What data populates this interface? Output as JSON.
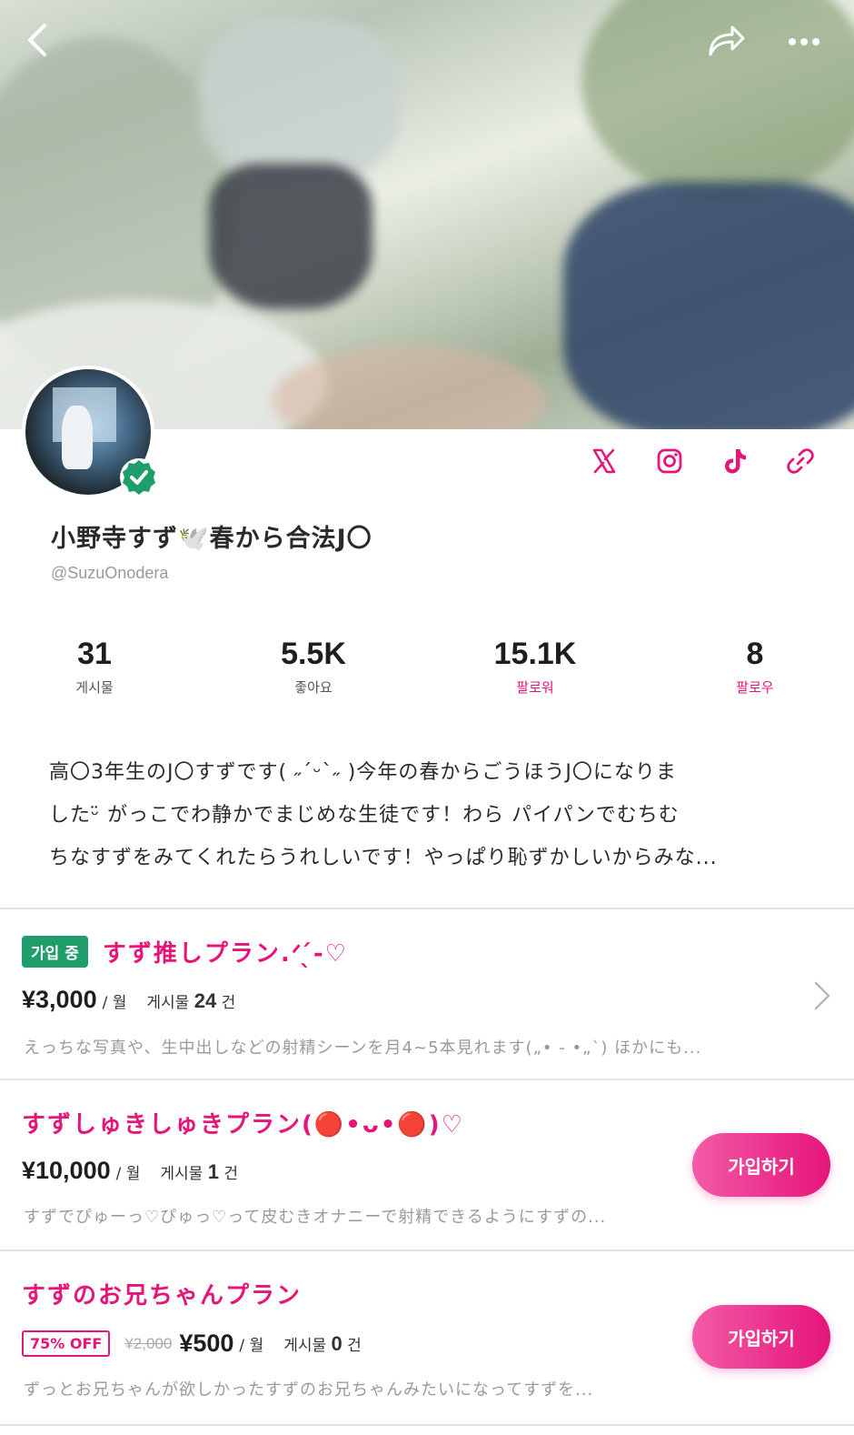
{
  "header": {
    "back_icon": "chevron-left-icon",
    "share_icon": "share-icon",
    "more_icon": "more-horizontal-icon"
  },
  "profile": {
    "display_name": "小野寺すず🕊️春から合法J〇",
    "handle": "@SuzuOnodera",
    "verified": true,
    "socials": [
      "x-icon",
      "instagram-icon",
      "tiktok-icon",
      "link-icon"
    ],
    "accent_color": "#e5157a"
  },
  "stats": [
    {
      "value": "31",
      "label": "게시물"
    },
    {
      "value": "5.5K",
      "label": "좋아요"
    },
    {
      "value": "15.1K",
      "label": "팔로워"
    },
    {
      "value": "8",
      "label": "팔로우"
    }
  ],
  "bio": {
    "lines": [
      "高〇3年生のJ〇すずです( ˶ˊᵕˋ˶ )今年の春からごうほうJ〇になりま",
      "したᵕ̈ がっこでわ静かでまじめな生徒です！わら パイパンでむちむ",
      "ちなすずをみてくれたらうれしいです！やっぱり恥ずかしいからみな..."
    ]
  },
  "plans": [
    {
      "status_badge": "가입 중",
      "title": "すず推しプラン.ᐟ‪‪‪‪‪‪‪‪‪‪‪‪‪‪‪‪‪‪‪‪‪‪‪‪‪‪‪ ̖́-‬♡",
      "price": "¥3,000",
      "per": "/ 월",
      "posts_label": "게시물",
      "posts_count": "24",
      "posts_unit": "건",
      "description": "えっちな写真や、生中出しなどの射精シーンを月4~5本見れます(„• ֊ •„`) ほかにも..."
    },
    {
      "title": "すずしゅきしゅきプラン(🔴•ᴗ•🔴)♡",
      "price": "¥10,000",
      "per": "/ 월",
      "posts_label": "게시물",
      "posts_count": "1",
      "posts_unit": "건",
      "join_label": "가입하기",
      "description": "すずでぴゅーっ♡ぴゅっ♡って皮むきオナニーで射精できるようにすずの..."
    },
    {
      "title": "すずのお兄ちゃんプラン",
      "discount_badge": "75% OFF",
      "old_price": "¥2,000",
      "price": "¥500",
      "per": "/ 월",
      "posts_label": "게시물",
      "posts_count": "0",
      "posts_unit": "건",
      "join_label": "가입하기",
      "description": "ずっとお兄ちゃんが欲しかったすずのお兄ちゃんみたいになってすずを..."
    }
  ]
}
